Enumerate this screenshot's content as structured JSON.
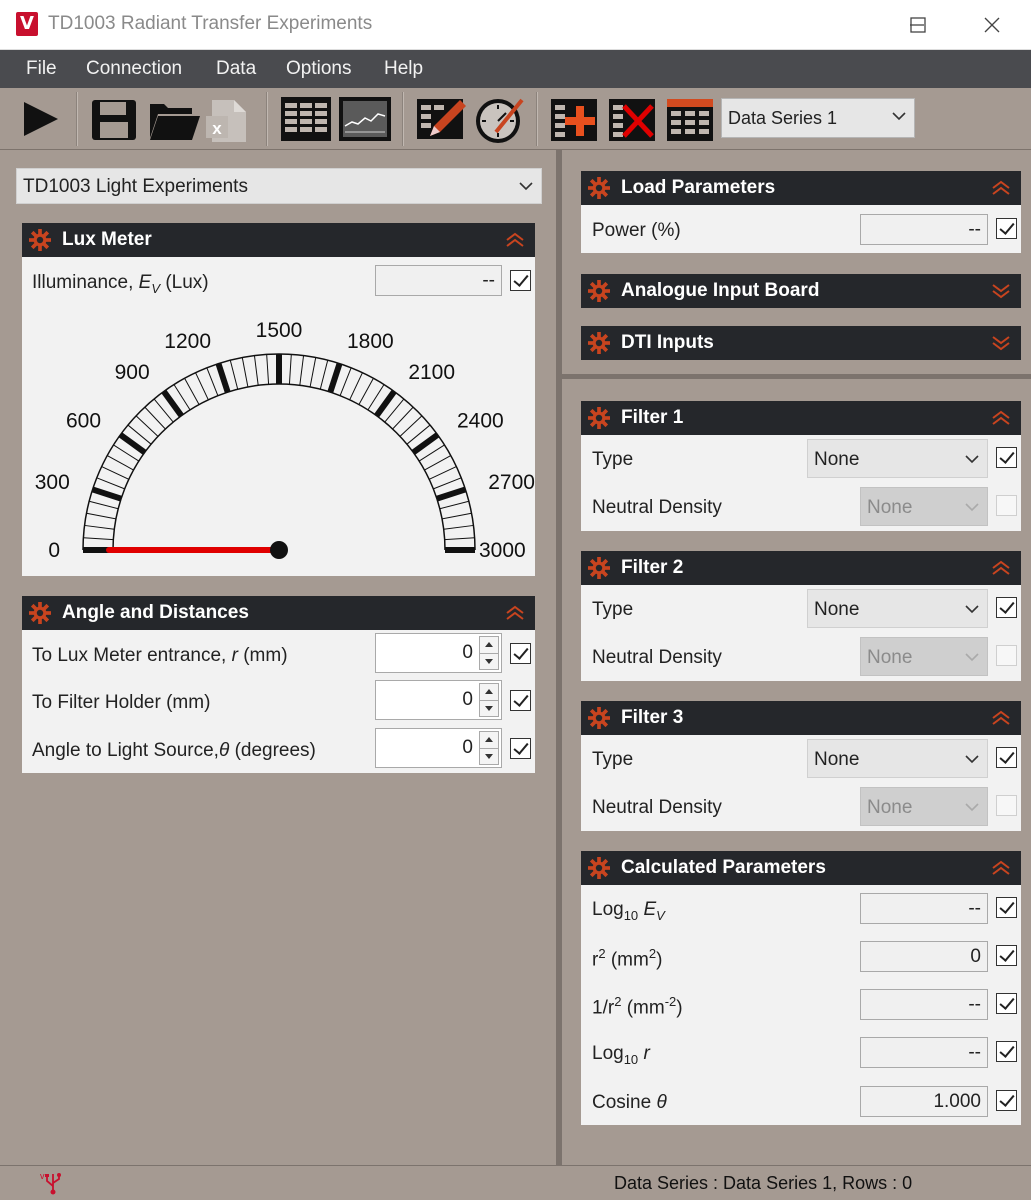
{
  "window": {
    "title": "TD1003 Radiant Transfer Experiments"
  },
  "menu": [
    "File",
    "Connection",
    "Data",
    "Options",
    "Help"
  ],
  "toolbar": {
    "series_select": "Data Series 1"
  },
  "experiment_select": "TD1003 Light Experiments",
  "lux_meter": {
    "title": "Lux Meter",
    "illuminance_label": "Illuminance,",
    "illuminance_symbol": "E",
    "illuminance_sub": "V",
    "illuminance_unit": "(Lux)",
    "illuminance_value": "--",
    "gauge": {
      "min": 0,
      "max": 3000,
      "value": 0,
      "ticks": [
        "0",
        "300",
        "600",
        "900",
        "1200",
        "1500",
        "1800",
        "2100",
        "2400",
        "2700",
        "3000"
      ]
    }
  },
  "angles": {
    "title": "Angle and Distances",
    "rows": [
      {
        "label": "To Lux Meter entrance,",
        "sym": "r",
        "unit": "(mm)",
        "value": "0"
      },
      {
        "label": "To Filter Holder (mm)",
        "sym": "",
        "unit": "",
        "value": "0"
      },
      {
        "label": "Angle to Light Source,",
        "sym": "θ",
        "unit": "(degrees)",
        "value": "0"
      }
    ]
  },
  "load_params": {
    "title": "Load Parameters",
    "power_label": "Power (%)",
    "power_value": "--"
  },
  "analogue": {
    "title": "Analogue Input Board"
  },
  "dti": {
    "title": "DTI Inputs"
  },
  "filters": [
    {
      "title": "Filter 1",
      "type_label": "Type",
      "type_value": "None",
      "nd_label": "Neutral Density",
      "nd_value": "None"
    },
    {
      "title": "Filter 2",
      "type_label": "Type",
      "type_value": "None",
      "nd_label": "Neutral Density",
      "nd_value": "None"
    },
    {
      "title": "Filter 3",
      "type_label": "Type",
      "type_value": "None",
      "nd_label": "Neutral Density",
      "nd_value": "None"
    }
  ],
  "calc": {
    "title": "Calculated Parameters",
    "rows": [
      {
        "value": "--"
      },
      {
        "value": "0"
      },
      {
        "value": "--"
      },
      {
        "value": "--"
      },
      {
        "value": "1.000"
      }
    ],
    "labels": {
      "log_ev": "Log",
      "log_sub": "10",
      "ev": "E",
      "ev_sub": "V",
      "r2": "r",
      "r2_sup": "2",
      "r2_unit_a": "(mm",
      "r2_unit_sup": "2",
      "r2_unit_b": ")",
      "inv": "1/r",
      "inv_sup": "2",
      "inv_unit_a": "(mm",
      "inv_unit_sup": "-2",
      "inv_unit_b": ")",
      "log_r": "Log",
      "log_r_sub": "10",
      "r": "r",
      "cos": "Cosine",
      "theta": "θ"
    }
  },
  "status": {
    "text": "Data Series : Data Series 1,  Rows : 0"
  },
  "colors": {
    "header": "#25272b",
    "gauge_needle": "#e00000",
    "gear": "#c8441f"
  }
}
